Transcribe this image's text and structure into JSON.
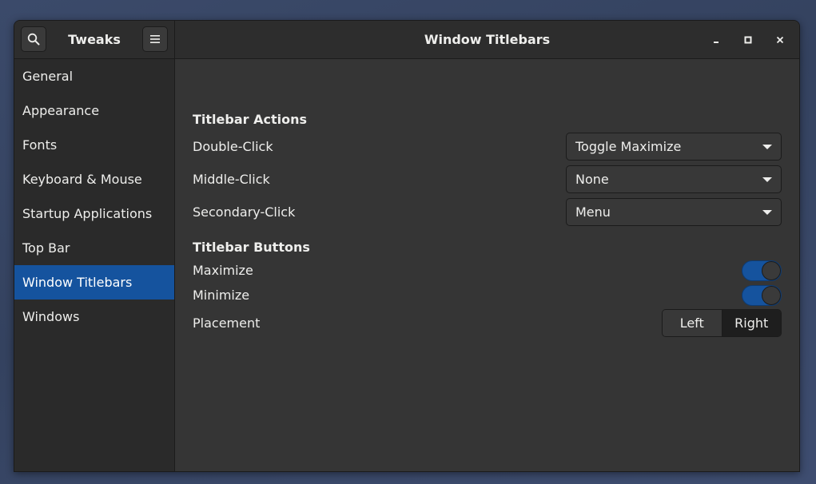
{
  "app": {
    "title": "Tweaks"
  },
  "window": {
    "title": "Window Titlebars"
  },
  "sidebar": {
    "items": [
      {
        "label": "General"
      },
      {
        "label": "Appearance"
      },
      {
        "label": "Fonts"
      },
      {
        "label": "Keyboard & Mouse"
      },
      {
        "label": "Startup Applications"
      },
      {
        "label": "Top Bar"
      },
      {
        "label": "Window Titlebars"
      },
      {
        "label": "Windows"
      }
    ],
    "selected": "Window Titlebars"
  },
  "titlebar_actions": {
    "heading": "Titlebar Actions",
    "double_click": {
      "label": "Double-Click",
      "value": "Toggle Maximize"
    },
    "middle_click": {
      "label": "Middle-Click",
      "value": "None"
    },
    "secondary_click": {
      "label": "Secondary-Click",
      "value": "Menu"
    }
  },
  "titlebar_buttons": {
    "heading": "Titlebar Buttons",
    "maximize": {
      "label": "Maximize",
      "enabled": true
    },
    "minimize": {
      "label": "Minimize",
      "enabled": true
    },
    "placement": {
      "label": "Placement",
      "options": [
        "Left",
        "Right"
      ],
      "selected": "Right"
    }
  },
  "icons": {
    "search": "search-icon",
    "menu": "hamburger-menu-icon",
    "minimize": "window-minimize-icon",
    "maximize": "window-maximize-icon",
    "close": "window-close-icon"
  },
  "colors": {
    "accent": "#15539e",
    "window_bg": "#353535",
    "sidebar_bg": "#2a2a2a",
    "headerbar_bg": "#2d2d2d"
  }
}
